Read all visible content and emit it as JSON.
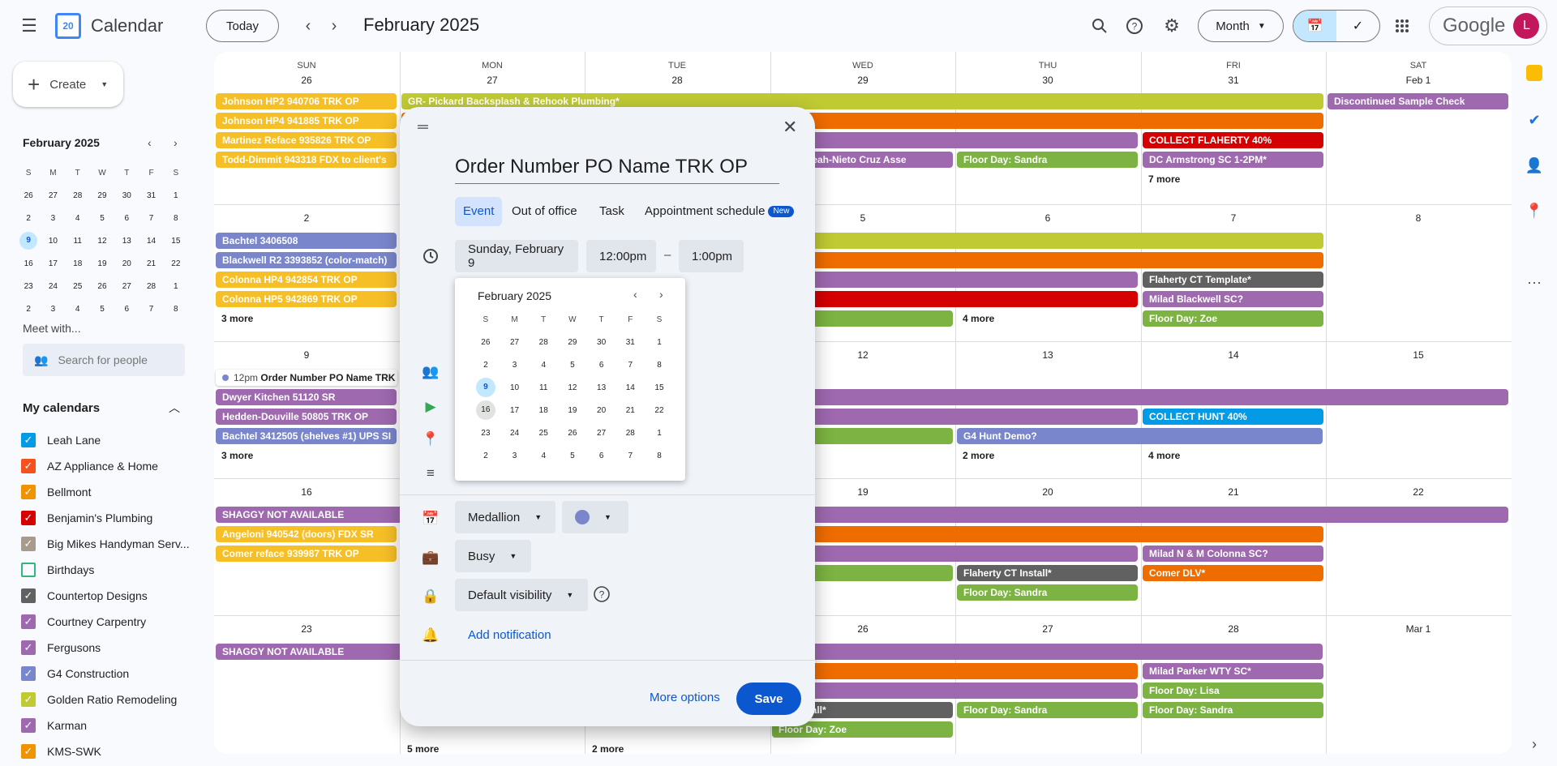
{
  "app": {
    "title": "Calendar",
    "logo_number": "20",
    "month_title": "February 2025",
    "today_label": "Today",
    "view_label": "Month",
    "google_label": "Google",
    "avatar_letter": "L"
  },
  "sidebar": {
    "create_label": "Create",
    "mini_title": "February 2025",
    "mini_weekdays": [
      "S",
      "M",
      "T",
      "W",
      "T",
      "F",
      "S"
    ],
    "mini_weeks": [
      [
        "26",
        "27",
        "28",
        "29",
        "30",
        "31",
        "1"
      ],
      [
        "2",
        "3",
        "4",
        "5",
        "6",
        "7",
        "8"
      ],
      [
        "9",
        "10",
        "11",
        "12",
        "13",
        "14",
        "15"
      ],
      [
        "16",
        "17",
        "18",
        "19",
        "20",
        "21",
        "22"
      ],
      [
        "23",
        "24",
        "25",
        "26",
        "27",
        "28",
        "1"
      ],
      [
        "2",
        "3",
        "4",
        "5",
        "6",
        "7",
        "8"
      ]
    ],
    "meet_title": "Meet with...",
    "people_placeholder": "Search for people",
    "my_calendars_title": "My calendars",
    "calendars": [
      {
        "name": "Leah Lane",
        "color": "#039be5",
        "checked": true
      },
      {
        "name": "AZ Appliance & Home",
        "color": "#f4511e",
        "checked": true
      },
      {
        "name": "Bellmont",
        "color": "#f09300",
        "checked": true
      },
      {
        "name": "Benjamin's Plumbing",
        "color": "#d50000",
        "checked": true
      },
      {
        "name": "Big Mikes Handyman Serv...",
        "color": "#a79b8e",
        "checked": true
      },
      {
        "name": "Birthdays",
        "color": "#33b679",
        "checked": false
      },
      {
        "name": "Countertop Designs",
        "color": "#616161",
        "checked": true
      },
      {
        "name": "Courtney Carpentry",
        "color": "#9e69af",
        "checked": true
      },
      {
        "name": "Fergusons",
        "color": "#9e69af",
        "checked": true
      },
      {
        "name": "G4 Construction",
        "color": "#7986cb",
        "checked": true
      },
      {
        "name": "Golden Ratio Remodeling",
        "color": "#c0ca33",
        "checked": true
      },
      {
        "name": "Karman",
        "color": "#9e69af",
        "checked": true
      },
      {
        "name": "KMS-SWK",
        "color": "#f09300",
        "checked": true
      }
    ]
  },
  "calendar": {
    "weekdays": [
      "SUN",
      "MON",
      "TUE",
      "WED",
      "THU",
      "FRI",
      "SAT"
    ],
    "day_numbers": [
      [
        "26",
        "27",
        "28",
        "29",
        "30",
        "31",
        "Feb 1"
      ],
      [
        "2",
        "3",
        "4",
        "5",
        "6",
        "7",
        "8"
      ],
      [
        "9",
        "10",
        "11",
        "12",
        "13",
        "14",
        "15"
      ],
      [
        "16",
        "17",
        "18",
        "19",
        "20",
        "21",
        "22"
      ],
      [
        "23",
        "24",
        "25",
        "26",
        "27",
        "28",
        "Mar 1"
      ]
    ],
    "events": [
      {
        "week": 0,
        "col": 0,
        "span": 1,
        "lane": 0,
        "title": "Johnson HP2 940706 TRK OP",
        "color": "#f6bf26"
      },
      {
        "week": 0,
        "col": 0,
        "span": 1,
        "lane": 1,
        "title": "Johnson HP4 941885 TRK OP",
        "color": "#f6bf26"
      },
      {
        "week": 0,
        "col": 0,
        "span": 1,
        "lane": 2,
        "title": "Martinez Reface 935826 TRK OP",
        "color": "#f6bf26"
      },
      {
        "week": 0,
        "col": 0,
        "span": 1,
        "lane": 3,
        "title": "Todd-Dimmit 943318 FDX to client's",
        "color": "#f6bf26"
      },
      {
        "week": 0,
        "col": 1,
        "span": 5,
        "lane": 0,
        "title": "GR- Pickard Backsplash & Rehook Plumbing*",
        "color": "#c0ca33"
      },
      {
        "week": 0,
        "col": 1,
        "span": 5,
        "lane": 1,
        "title": "",
        "color": "#ef6c00"
      },
      {
        "week": 0,
        "col": 1,
        "span": 4,
        "lane": 2,
        "title": "",
        "color": "#9e69af"
      },
      {
        "week": 0,
        "col": 3,
        "span": 1,
        "lane": 3,
        "title": "red & Leah-Nieto Cruz Asse",
        "color": "#9e69af"
      },
      {
        "week": 0,
        "col": 4,
        "span": 1,
        "lane": 3,
        "title": "Floor Day: Sandra",
        "color": "#7cb342"
      },
      {
        "week": 0,
        "col": 5,
        "span": 1,
        "lane": 2,
        "title": "COLLECT FLAHERTY 40%",
        "color": "#d50000"
      },
      {
        "week": 0,
        "col": 5,
        "span": 1,
        "lane": 3,
        "title": "DC Armstrong SC 1-2PM*",
        "color": "#9e69af"
      },
      {
        "week": 0,
        "col": 6,
        "span": 1,
        "lane": 0,
        "title": "Discontinued Sample Check",
        "color": "#9e69af"
      },
      {
        "week": 1,
        "col": 0,
        "span": 1,
        "lane": 0,
        "title": "Bachtel 3406508",
        "color": "#7986cb"
      },
      {
        "week": 1,
        "col": 0,
        "span": 1,
        "lane": 1,
        "title": "Blackwell R2 3393852 (color-match)",
        "color": "#7986cb"
      },
      {
        "week": 1,
        "col": 0,
        "span": 1,
        "lane": 2,
        "title": "Colonna HP4 942854 TRK OP",
        "color": "#f6bf26"
      },
      {
        "week": 1,
        "col": 0,
        "span": 1,
        "lane": 3,
        "title": "Colonna HP5 942869 TRK OP",
        "color": "#f6bf26"
      },
      {
        "week": 1,
        "col": 1,
        "span": 5,
        "lane": 0,
        "title": "",
        "color": "#c0ca33"
      },
      {
        "week": 1,
        "col": 1,
        "span": 5,
        "lane": 1,
        "title": "",
        "color": "#ef6c00"
      },
      {
        "week": 1,
        "col": 1,
        "span": 4,
        "lane": 2,
        "title": "",
        "color": "#9e69af"
      },
      {
        "week": 1,
        "col": 1,
        "span": 4,
        "lane": 3,
        "title": "",
        "color": "#d50000"
      },
      {
        "week": 1,
        "col": 3,
        "span": 1,
        "lane": 4,
        "title": "y: Zoe",
        "color": "#7cb342"
      },
      {
        "week": 1,
        "col": 5,
        "span": 1,
        "lane": 2,
        "title": "Flaherty CT Template*",
        "color": "#616161"
      },
      {
        "week": 1,
        "col": 5,
        "span": 1,
        "lane": 3,
        "title": "Milad Blackwell SC?",
        "color": "#9e69af"
      },
      {
        "week": 1,
        "col": 5,
        "span": 1,
        "lane": 4,
        "title": "Floor Day: Zoe",
        "color": "#7cb342"
      },
      {
        "week": 2,
        "col": 0,
        "span": 1,
        "lane": 1,
        "title": "Dwyer Kitchen 51120 SR",
        "color": "#9e69af"
      },
      {
        "week": 2,
        "col": 0,
        "span": 1,
        "lane": 2,
        "title": "Hedden-Douville 50805 TRK OP",
        "color": "#9e69af"
      },
      {
        "week": 2,
        "col": 0,
        "span": 1,
        "lane": 3,
        "title": "Bachtel 3412505 (shelves #1) UPS SI",
        "color": "#7986cb"
      },
      {
        "week": 2,
        "col": 1,
        "span": 6,
        "lane": 1,
        "title": "",
        "color": "#9e69af"
      },
      {
        "week": 2,
        "col": 1,
        "span": 4,
        "lane": 2,
        "title": "",
        "color": "#9e69af"
      },
      {
        "week": 2,
        "col": 3,
        "span": 1,
        "lane": 3,
        "title": "y: Zoe",
        "color": "#7cb342"
      },
      {
        "week": 2,
        "col": 4,
        "span": 2,
        "lane": 3,
        "title": "G4 Hunt Demo?",
        "color": "#7986cb"
      },
      {
        "week": 2,
        "col": 5,
        "span": 1,
        "lane": 2,
        "title": "COLLECT HUNT 40%",
        "color": "#039be5"
      },
      {
        "week": 3,
        "col": 0,
        "span": 7,
        "lane": 0,
        "title": "SHAGGY NOT AVAILABLE",
        "color": "#9e69af"
      },
      {
        "week": 3,
        "col": 0,
        "span": 1,
        "lane": 1,
        "title": "Angeloni 940542 (doors) FDX SR",
        "color": "#f6bf26"
      },
      {
        "week": 3,
        "col": 0,
        "span": 1,
        "lane": 2,
        "title": "Comer reface 939987 TRK OP",
        "color": "#f6bf26"
      },
      {
        "week": 3,
        "col": 1,
        "span": 5,
        "lane": 1,
        "title": "",
        "color": "#ef6c00"
      },
      {
        "week": 3,
        "col": 1,
        "span": 4,
        "lane": 2,
        "title": "",
        "color": "#9e69af"
      },
      {
        "week": 3,
        "col": 3,
        "span": 1,
        "lane": 3,
        "title": "y: Zoe",
        "color": "#7cb342"
      },
      {
        "week": 3,
        "col": 4,
        "span": 1,
        "lane": 3,
        "title": "Flaherty CT Install*",
        "color": "#616161"
      },
      {
        "week": 3,
        "col": 4,
        "span": 1,
        "lane": 4,
        "title": "Floor Day: Sandra",
        "color": "#7cb342"
      },
      {
        "week": 3,
        "col": 5,
        "span": 1,
        "lane": 2,
        "title": "Milad N & M Colonna SC?",
        "color": "#9e69af"
      },
      {
        "week": 3,
        "col": 5,
        "span": 1,
        "lane": 3,
        "title": "Comer DLV*",
        "color": "#ef6c00"
      },
      {
        "week": 4,
        "col": 0,
        "span": 6,
        "lane": 0,
        "title": "SHAGGY NOT AVAILABLE",
        "color": "#9e69af"
      },
      {
        "week": 4,
        "col": 1,
        "span": 4,
        "lane": 1,
        "title": "",
        "color": "#ef6c00"
      },
      {
        "week": 4,
        "col": 1,
        "span": 4,
        "lane": 2,
        "title": "",
        "color": "#9e69af"
      },
      {
        "week": 4,
        "col": 3,
        "span": 1,
        "lane": 3,
        "title": "CT Install*",
        "color": "#616161"
      },
      {
        "week": 4,
        "col": 3,
        "span": 1,
        "lane": 4,
        "title": "Floor Day: Zoe",
        "color": "#7cb342"
      },
      {
        "week": 4,
        "col": 4,
        "span": 1,
        "lane": 3,
        "title": "Floor Day: Sandra",
        "color": "#7cb342"
      },
      {
        "week": 4,
        "col": 5,
        "span": 1,
        "lane": 1,
        "title": "Milad Parker WTY SC*",
        "color": "#9e69af"
      },
      {
        "week": 4,
        "col": 5,
        "span": 1,
        "lane": 2,
        "title": "Floor Day: Lisa",
        "color": "#7cb342"
      },
      {
        "week": 4,
        "col": 5,
        "span": 1,
        "lane": 3,
        "title": "Floor Day: Sandra",
        "color": "#7cb342"
      }
    ],
    "more_links": [
      {
        "week": 0,
        "col": 5,
        "lane": 4,
        "label": "7 more"
      },
      {
        "week": 1,
        "col": 0,
        "lane": 4,
        "label": "3 more"
      },
      {
        "week": 1,
        "col": 4,
        "lane": 4,
        "label": "4 more"
      },
      {
        "week": 2,
        "col": 0,
        "lane": 4,
        "label": "3 more"
      },
      {
        "week": 2,
        "col": 4,
        "lane": 4,
        "label": "2 more"
      },
      {
        "week": 2,
        "col": 5,
        "lane": 4,
        "label": "4 more"
      },
      {
        "week": 4,
        "col": 1,
        "lane": 5,
        "label": "5 more"
      },
      {
        "week": 4,
        "col": 2,
        "lane": 5,
        "label": "2 more"
      }
    ],
    "timed_event": {
      "time": "12pm",
      "title": "Order Number PO Name TRK"
    }
  },
  "dialog": {
    "title": "Order Number PO Name TRK OP",
    "tabs": [
      "Event",
      "Out of office",
      "Task",
      "Appointment schedule"
    ],
    "new_badge": "New",
    "date": "Sunday, February 9",
    "start_time": "12:00pm",
    "dash": "–",
    "end_time": "1:00pm",
    "picker_title": "February 2025",
    "description_fragment": "nt",
    "calendar_name": "Medallion",
    "event_color": "#7986cb",
    "availability": "Busy",
    "visibility": "Default visibility",
    "add_notification": "Add notification",
    "more_options": "More options",
    "save": "Save"
  }
}
